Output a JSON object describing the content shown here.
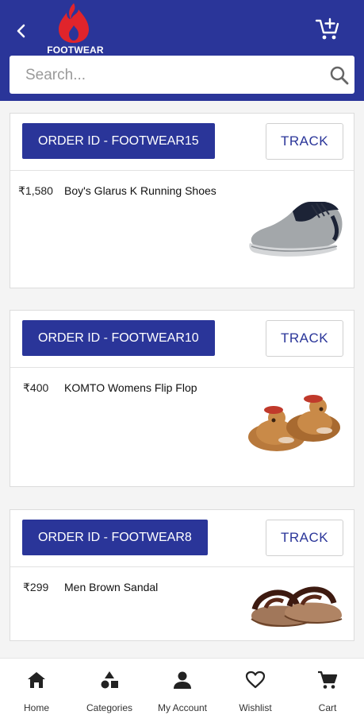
{
  "header": {
    "logo_text": "FOOTWEAR",
    "back_icon": "arrow-back-icon",
    "cart_icon": "add-shopping-cart-icon"
  },
  "search": {
    "placeholder": "Search...",
    "icon": "search-icon"
  },
  "orders": [
    {
      "order_id": "ORDER ID - FOOTWEAR15",
      "track_label": "TRACK",
      "price": "₹1,580",
      "product": "Boy's Glarus K Running Shoes"
    },
    {
      "order_id": "ORDER ID - FOOTWEAR10",
      "track_label": "TRACK",
      "price": "₹400",
      "product": "KOMTO Womens Flip Flop"
    },
    {
      "order_id": "ORDER ID - FOOTWEAR8",
      "track_label": "TRACK",
      "price": "₹299",
      "product": "Men Brown Sandal"
    }
  ],
  "bottom_nav": [
    {
      "label": "Home",
      "icon": "home-icon"
    },
    {
      "label": "Categories",
      "icon": "categories-icon"
    },
    {
      "label": "My Account",
      "icon": "account-icon"
    },
    {
      "label": "Wishlist",
      "icon": "heart-icon"
    },
    {
      "label": "Cart",
      "icon": "cart-icon"
    }
  ],
  "colors": {
    "primary": "#2a3599",
    "accent": "#e0242b"
  }
}
